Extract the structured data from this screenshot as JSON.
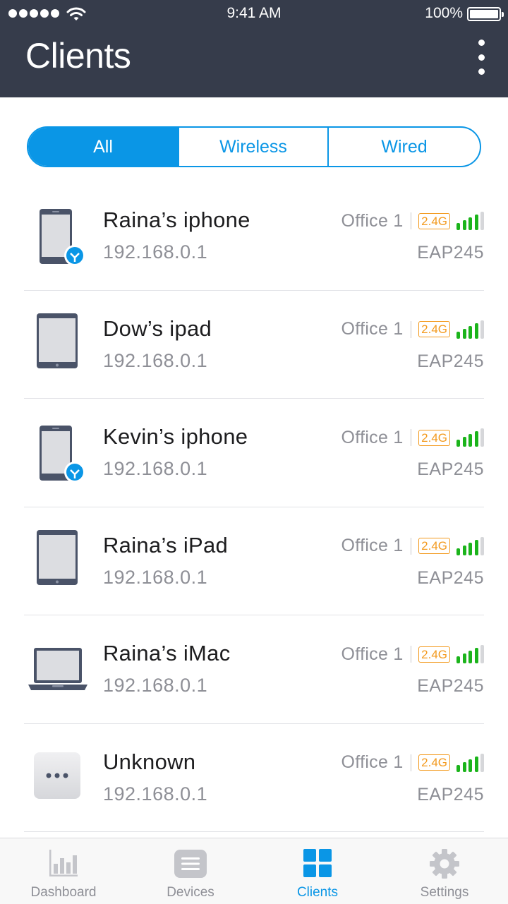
{
  "status_bar": {
    "time": "9:41 AM",
    "battery": "100%"
  },
  "header": {
    "title": "Clients",
    "menu_icon": "more-vertical-icon"
  },
  "filter": {
    "segments": [
      "All",
      "Wireless",
      "Wired"
    ],
    "selected": "All"
  },
  "clients": [
    {
      "name": "Raina’s iphone",
      "ip": "192.168.0.1",
      "site": "Office 1",
      "band": "2.4G",
      "ap": "EAP245",
      "device": "phone",
      "badge": "download-badge-icon",
      "signal_level": 4,
      "signal_max": 5
    },
    {
      "name": "Dow’s ipad",
      "ip": "192.168.0.1",
      "site": "Office 1",
      "band": "2.4G",
      "ap": "EAP245",
      "device": "tablet",
      "signal_level": 4,
      "signal_max": 5
    },
    {
      "name": "Kevin’s iphone",
      "ip": "192.168.0.1",
      "site": "Office 1",
      "band": "2.4G",
      "ap": "EAP245",
      "device": "phone",
      "badge": "download-badge-icon",
      "signal_level": 4,
      "signal_max": 5
    },
    {
      "name": "Raina’s iPad",
      "ip": "192.168.0.1",
      "site": "Office 1",
      "band": "2.4G",
      "ap": "EAP245",
      "device": "tablet",
      "signal_level": 4,
      "signal_max": 5
    },
    {
      "name": "Raina’s iMac",
      "ip": "192.168.0.1",
      "site": "Office 1",
      "band": "2.4G",
      "ap": "EAP245",
      "device": "laptop",
      "signal_level": 4,
      "signal_max": 5
    },
    {
      "name": "Unknown",
      "ip": "192.168.0.1",
      "site": "Office 1",
      "band": "2.4G",
      "ap": "EAP245",
      "device": "unknown",
      "signal_level": 4,
      "signal_max": 5
    }
  ],
  "tabs": [
    {
      "label": "Dashboard",
      "icon": "bar-chart-icon",
      "active": false
    },
    {
      "label": "Devices",
      "icon": "devices-list-icon",
      "active": false
    },
    {
      "label": "Clients",
      "icon": "grid-icon",
      "active": true
    },
    {
      "label": "Settings",
      "icon": "gear-icon",
      "active": false
    }
  ],
  "colors": {
    "header_bg": "#363c4b",
    "accent": "#0a96e6",
    "signal_green": "#1bb41b",
    "band_orange": "#f39a1e",
    "icon_slate": "#4a5368"
  }
}
